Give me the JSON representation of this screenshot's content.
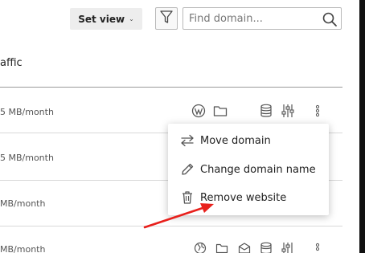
{
  "toolbar": {
    "set_view_label": "Set view",
    "set_view_chevron": "⌄",
    "search_placeholder": "Find domain..."
  },
  "table": {
    "column_header": "affic",
    "rows": [
      {
        "traffic": "5 MB/month"
      },
      {
        "traffic": "5 MB/month"
      },
      {
        "traffic": "MB/month"
      },
      {
        "traffic": "MB/month"
      }
    ]
  },
  "context_menu": {
    "items": [
      {
        "label": "Move domain",
        "icon": "swap-arrows-icon"
      },
      {
        "label": "Change domain name",
        "icon": "pencil-icon"
      },
      {
        "label": "Remove website",
        "icon": "trash-icon"
      }
    ]
  },
  "annotation": {
    "arrow_color": "#e8201c"
  }
}
